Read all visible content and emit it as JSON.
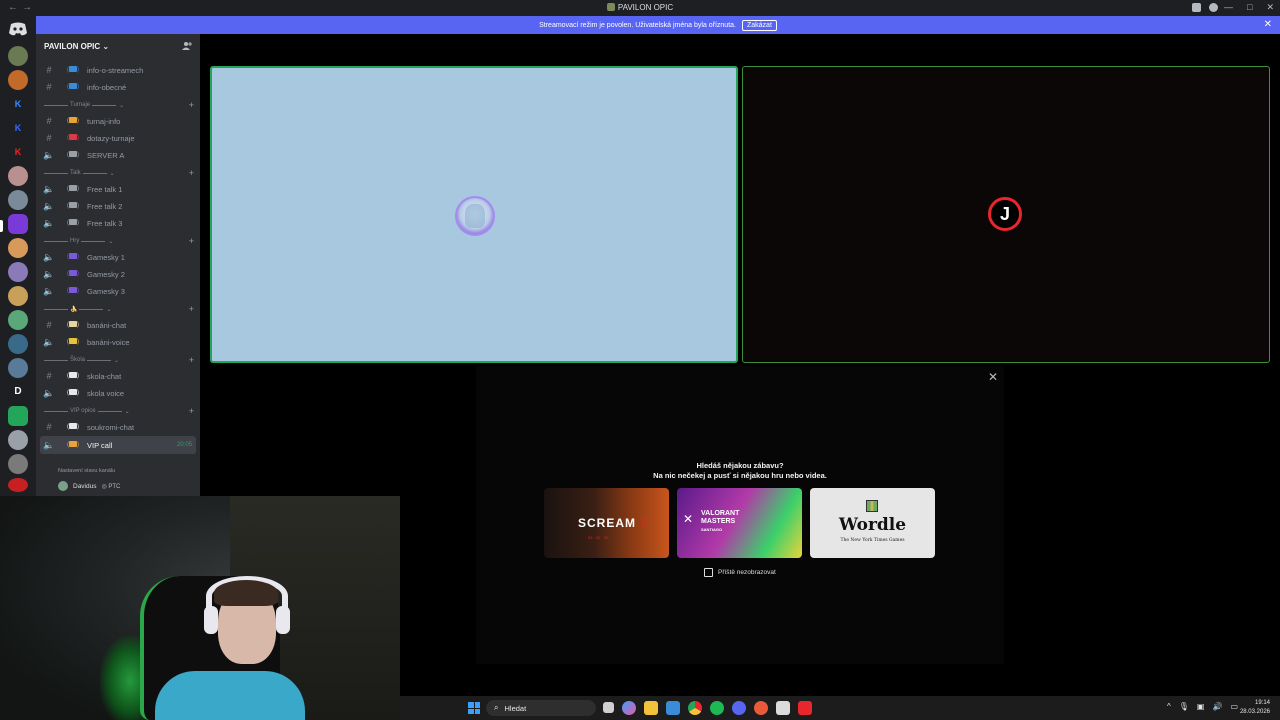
{
  "window": {
    "title": "PAVILON OPIC"
  },
  "banner": {
    "text": "Streamovací režim je povolen. Uživatelská jména byla oříznuta.",
    "disable_label": "Zakázat"
  },
  "server": {
    "name": "PAVILON OPIC"
  },
  "channels": [
    {
      "type": "text",
      "name": "info-o-streamech"
    },
    {
      "type": "text",
      "name": "info-obecné"
    },
    {
      "type": "category",
      "name": "Turnaje"
    },
    {
      "type": "text",
      "name": "turnaj-info"
    },
    {
      "type": "text",
      "name": "dotazy-turnaje"
    },
    {
      "type": "voice",
      "name": "SERVER A"
    },
    {
      "type": "category",
      "name": "Talk"
    },
    {
      "type": "voice",
      "name": "Free talk 1"
    },
    {
      "type": "voice",
      "name": "Free talk 2"
    },
    {
      "type": "voice",
      "name": "Free talk 3"
    },
    {
      "type": "category",
      "name": "Hry"
    },
    {
      "type": "voice",
      "name": "Gamesky 1"
    },
    {
      "type": "voice",
      "name": "Gamesky 2"
    },
    {
      "type": "voice",
      "name": "Gamesky 3"
    },
    {
      "type": "category",
      "name": "🍌"
    },
    {
      "type": "text",
      "name": "banáni-chat"
    },
    {
      "type": "voice",
      "name": "banáni-voice"
    },
    {
      "type": "category",
      "name": "Škola"
    },
    {
      "type": "text",
      "name": "skola-chat"
    },
    {
      "type": "voice",
      "name": "skola voice"
    },
    {
      "type": "category",
      "name": "VIP opice"
    },
    {
      "type": "text",
      "name": "soukromi-chat"
    },
    {
      "type": "voice",
      "name": "VIP call",
      "active": true,
      "time": "20:05"
    }
  ],
  "active_channel": {
    "status_hint": "Nastavení stavu kanálu",
    "user_name": "Davidus",
    "user_tag": "PTC"
  },
  "activity": {
    "question": "Hledáš nějakou zábavu?",
    "subtitle": "Na nic nečekej a pusť si nějakou hru nebo videa.",
    "cards": [
      {
        "name": "SCREAM 7",
        "subtext": "03 · 02 · 03"
      },
      {
        "name": "VALORANT MASTERS",
        "subtext": "SANTIAGO"
      },
      {
        "name": "Wordle",
        "subtext": "The New York Times Games"
      }
    ],
    "dont_show_label": "Příště nezobrazovat"
  },
  "taskbar": {
    "search_placeholder": "Hledat",
    "time": "19:14",
    "date": "28.03.2026"
  },
  "colors": {
    "accent": "#5865f2",
    "speaking": "#23a55a",
    "sidebar": "#2b2d31",
    "rail": "#1e1f22"
  }
}
